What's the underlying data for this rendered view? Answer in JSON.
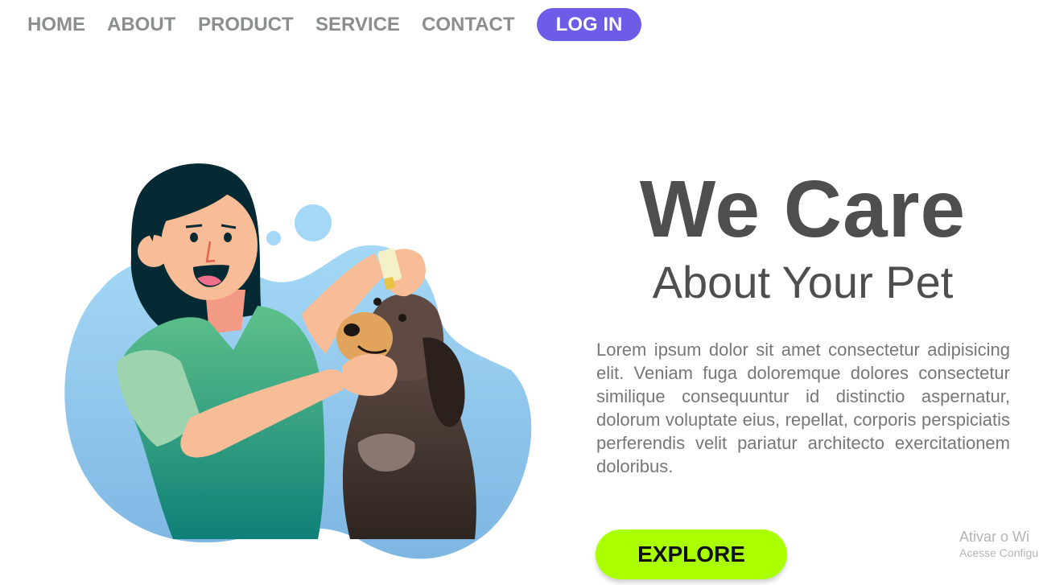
{
  "nav": {
    "items": [
      {
        "label": "HOME"
      },
      {
        "label": "ABOUT"
      },
      {
        "label": "PRODUCT"
      },
      {
        "label": "SERVICE"
      },
      {
        "label": "CONTACT"
      }
    ],
    "login_label": "LOG IN"
  },
  "hero": {
    "title": "We Care",
    "subtitle": "About Your Pet",
    "text": "Lorem ipsum dolor sit amet consectetur adipisicing elit. Veniam fuga doloremque dolores consectetur similique consequuntur id distinctio aspernatur, dolorum voluptate eius, repellat, corporis perspiciatis perferendis velit pariatur architecto exercitationem doloribus.",
    "explore_label": "EXPLORE"
  },
  "illustration": {
    "subject": "woman-giving-dog-eye-drops-icon"
  },
  "watermark": {
    "line1": "Ativar o Wi",
    "line2": "Acesse Configu"
  },
  "colors": {
    "nav_text": "#8a8f8c",
    "login_bg": "#6c5ce7",
    "explore_bg": "#aaff00",
    "heading": "#4e4e4e",
    "body_text": "#777777",
    "blob_blue": "#8ec6ec"
  }
}
